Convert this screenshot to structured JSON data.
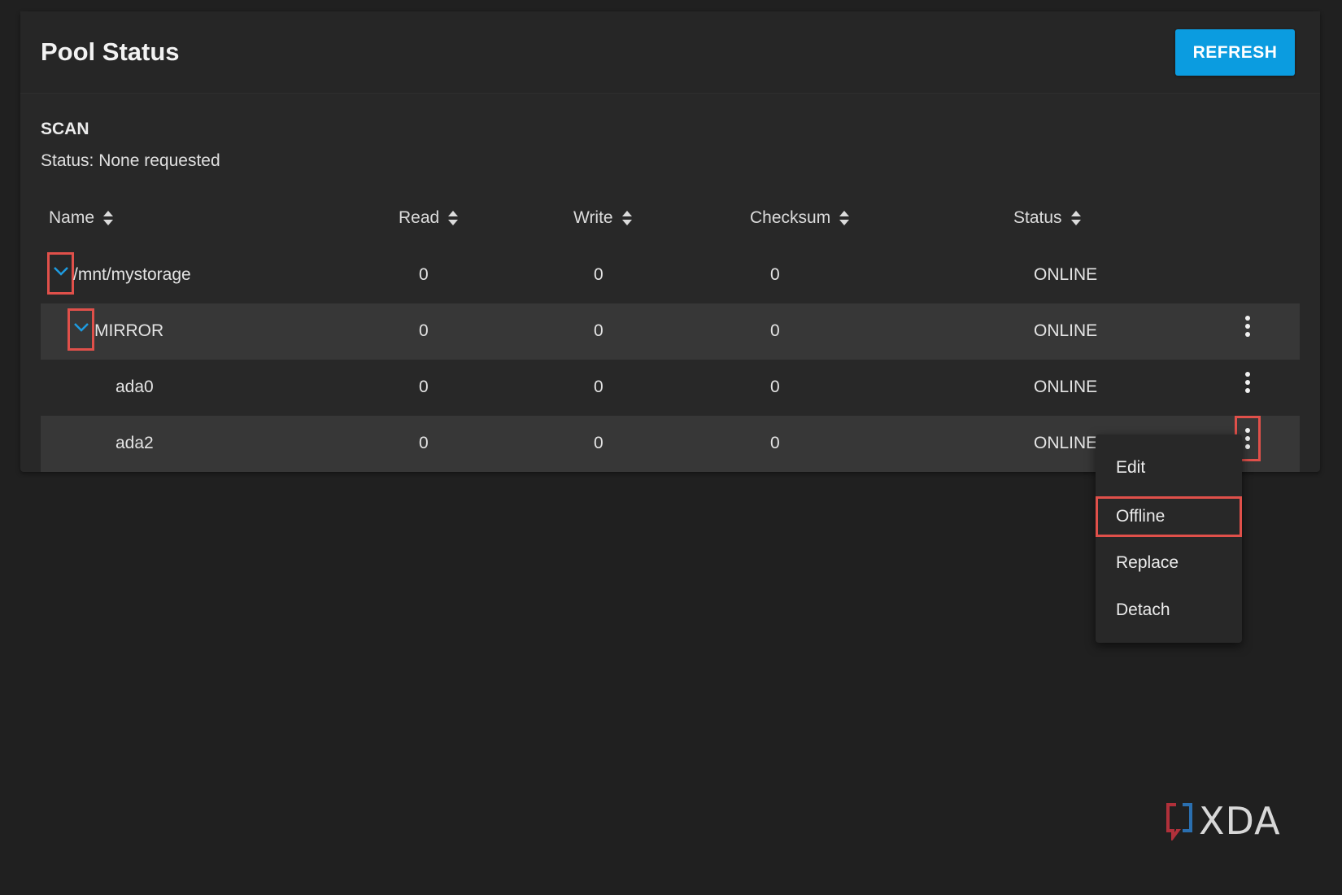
{
  "header": {
    "title": "Pool Status",
    "refresh_label": "REFRESH"
  },
  "scan": {
    "title": "SCAN",
    "status": "Status: None requested"
  },
  "table": {
    "columns": [
      {
        "label": "Name"
      },
      {
        "label": "Read"
      },
      {
        "label": "Write"
      },
      {
        "label": "Checksum"
      },
      {
        "label": "Status"
      }
    ],
    "rows": [
      {
        "name": "/mnt/mystorage",
        "read": "0",
        "write": "0",
        "checksum": "0",
        "status": "ONLINE"
      },
      {
        "name": "MIRROR",
        "read": "0",
        "write": "0",
        "checksum": "0",
        "status": "ONLINE"
      },
      {
        "name": "ada0",
        "read": "0",
        "write": "0",
        "checksum": "0",
        "status": "ONLINE"
      },
      {
        "name": "ada2",
        "read": "0",
        "write": "0",
        "checksum": "0",
        "status": "ONLINE"
      }
    ]
  },
  "context_menu": {
    "items": [
      {
        "label": "Edit"
      },
      {
        "label": "Offline"
      },
      {
        "label": "Replace"
      },
      {
        "label": "Detach"
      }
    ]
  },
  "watermark": {
    "text": "XDA"
  },
  "colors": {
    "background": "#202020",
    "card": "#282828",
    "accent_button": "#0b9ce0",
    "chevron": "#1e9be0",
    "highlight_box": "#e0504a",
    "shaded_row": "#373737"
  },
  "icons": {
    "sort": "sort-updown-icon",
    "expand": "chevron-down-icon",
    "more": "more-vert-icon"
  }
}
